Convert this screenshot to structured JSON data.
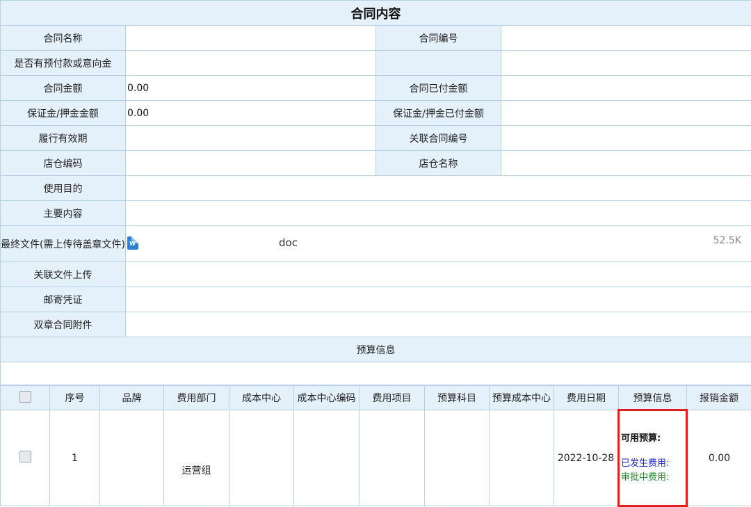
{
  "contract": {
    "title": "合同内容",
    "fields": {
      "name_label": "合同名称",
      "number_label": "合同编号",
      "prepay_label": "是否有预付款或意向金",
      "amount_label": "合同金额",
      "amount_value": "0.00",
      "paid_label": "合同已付金额",
      "deposit_label": "保证金/押金金额",
      "deposit_value": "0.00",
      "deposit_paid_label": "保证金/押金已付金额",
      "validity_label": "履行有效期",
      "related_no_label": "关联合同编号",
      "store_code_label": "店仓编码",
      "store_name_label": "店仓名称",
      "purpose_label": "使用目的",
      "main_content_label": "主要内容",
      "final_file_label": "最终文件(需上传待盖章文件)",
      "final_file_name": "doc",
      "final_file_size": "52.5K",
      "related_upload_label": "关联文件上传",
      "mail_proof_label": "邮寄凭证",
      "double_seal_label": "双章合同附件"
    },
    "budget_section_title": "预算信息"
  },
  "grid": {
    "headers": [
      "序号",
      "品牌",
      "费用部门",
      "成本中心",
      "成本中心编码",
      "费用项目",
      "预算科目",
      "预算成本中心",
      "费用日期",
      "预算信息",
      "报销金额"
    ],
    "rows": [
      {
        "index": "1",
        "brand": "",
        "dept": "运营组",
        "cost_center": "",
        "cost_center_code": "",
        "expense_item": "",
        "budget_subject": "",
        "budget_cost_center": "",
        "date": "2022-10-28",
        "budget_available": "可用预算:",
        "budget_spent": "已发生费用:",
        "budget_pending": "审批中费用:",
        "amount": "0.00"
      }
    ]
  },
  "colors": {
    "label_bg": "#e4f0fa",
    "border": "#b8cfe3",
    "highlight": "#e0201f",
    "spent": "#1a24d4",
    "pending": "#1f8a2b"
  },
  "icons": [
    "word-file-icon",
    "checkbox-icon"
  ]
}
